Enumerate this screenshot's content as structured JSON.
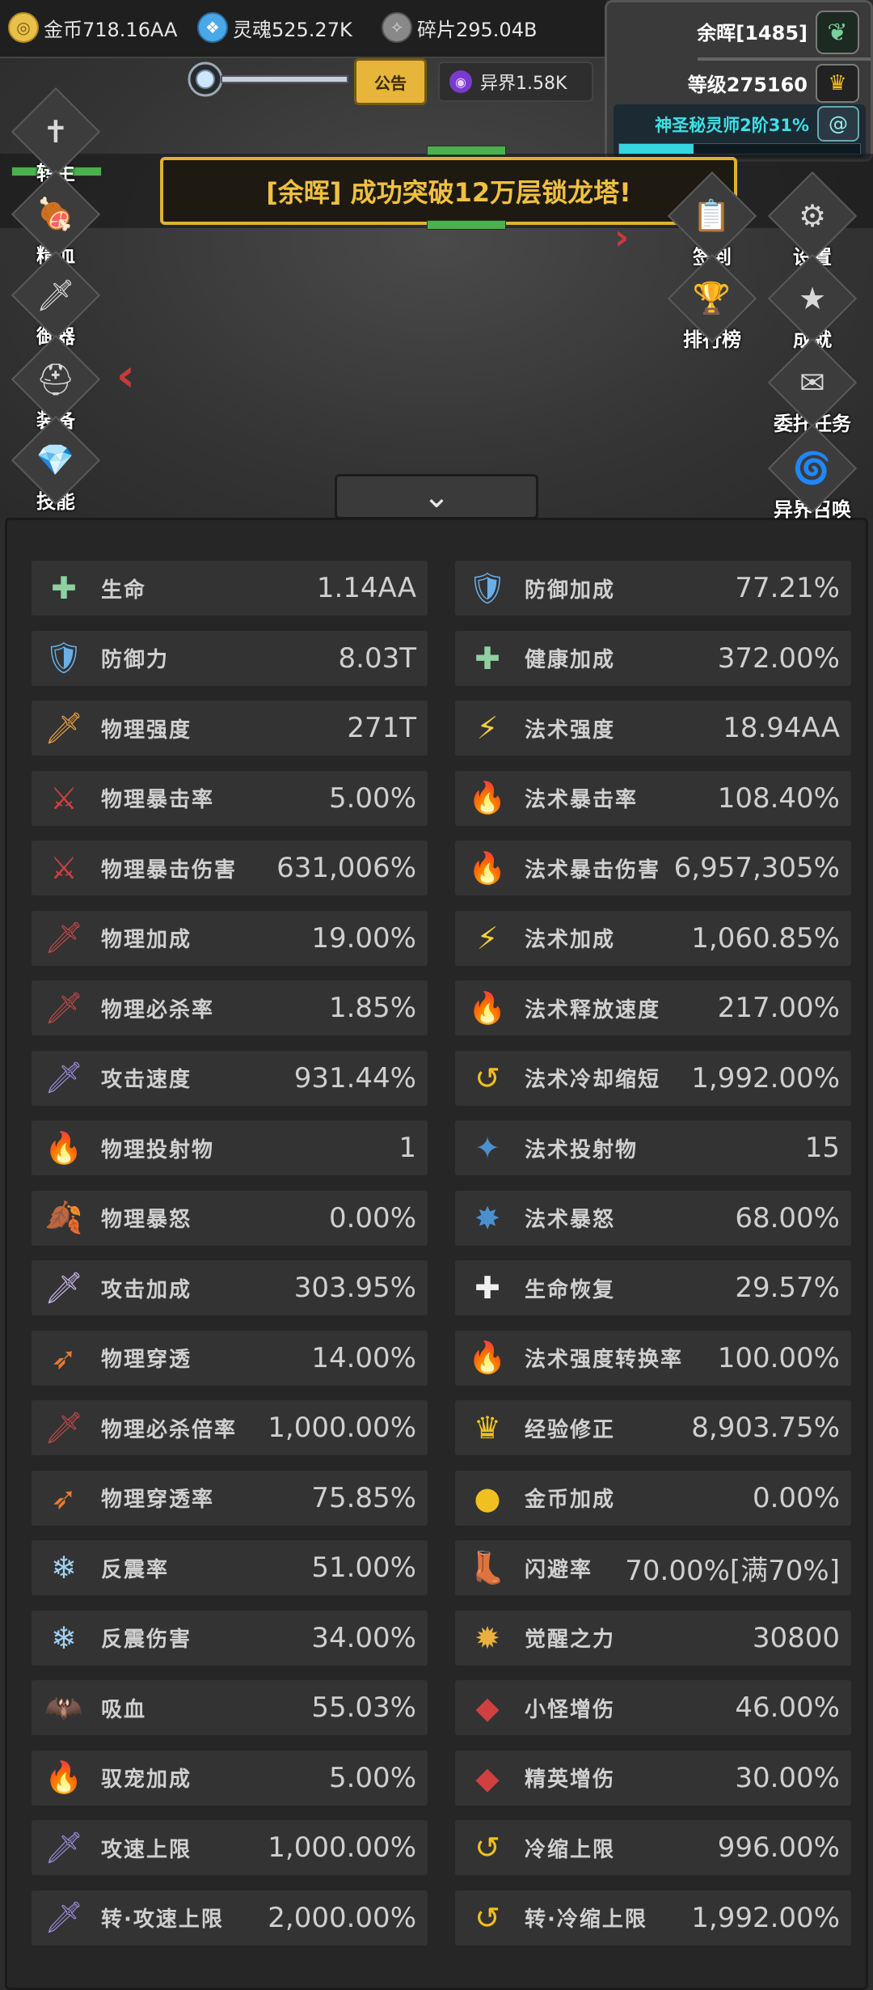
{
  "resources": {
    "gold": {
      "icon": "gold-coin-icon",
      "text": "金币718.16AA"
    },
    "soul": {
      "icon": "soul-flame-icon",
      "text": "灵魂525.27K"
    },
    "shard": {
      "icon": "shard-icon",
      "text": "碎片295.04B"
    }
  },
  "profile": {
    "name": "余晖[1485]",
    "level": "等级275160",
    "title": "神圣秘灵师2阶31%",
    "title_progress": 0.31
  },
  "notice_label": "公告",
  "otherworld_text": "异界1.58K",
  "banner_text": "[余晖] 成功突破12万层锁龙塔!",
  "left_menu": [
    {
      "label": "转生",
      "icon": "sword-cross-icon",
      "glyph": "✝"
    },
    {
      "label": "精血",
      "icon": "meat-icon",
      "glyph": "🍖"
    },
    {
      "label": "御器",
      "icon": "flying-sword-icon",
      "glyph": "🗡"
    },
    {
      "label": "装备",
      "icon": "helmet-icon",
      "glyph": "⛑"
    },
    {
      "label": "技能",
      "icon": "crystal-icon",
      "glyph": "💎"
    }
  ],
  "right_menu": [
    {
      "label": "签到",
      "icon": "signin-board-icon",
      "glyph": "📋"
    },
    {
      "label": "设置",
      "icon": "gear-icon",
      "glyph": "⚙"
    },
    {
      "label": "排行榜",
      "icon": "trophy-icon",
      "glyph": "🏆"
    },
    {
      "label": "成就",
      "icon": "star-icon",
      "glyph": "★"
    },
    {
      "label": "委托任务",
      "icon": "envelope-icon",
      "glyph": "✉"
    },
    {
      "label": "异界召唤",
      "icon": "portal-icon",
      "glyph": "🌀"
    }
  ],
  "stats_left": [
    {
      "name": "生命",
      "value": "1.14AA",
      "icon": "life-cross-icon",
      "glyph": "✚",
      "color": "#8fd0a0"
    },
    {
      "name": "防御力",
      "value": "8.03T",
      "icon": "shield-icon",
      "glyph": "🛡",
      "color": "#6ab0e8"
    },
    {
      "name": "物理强度",
      "value": "271T",
      "icon": "fire-blade-icon",
      "glyph": "🗡",
      "color": "#e8a040"
    },
    {
      "name": "物理暴击率",
      "value": "5.00%",
      "icon": "red-slash-icon",
      "glyph": "⚔",
      "color": "#d04040"
    },
    {
      "name": "物理暴击伤害",
      "value": "631,006%",
      "icon": "red-slash-icon",
      "glyph": "⚔",
      "color": "#d04040"
    },
    {
      "name": "物理加成",
      "value": "19.00%",
      "icon": "bleeding-blade-icon",
      "glyph": "🗡",
      "color": "#c04848"
    },
    {
      "name": "物理必杀率",
      "value": "1.85%",
      "icon": "bleeding-blade-icon",
      "glyph": "🗡",
      "color": "#c04848"
    },
    {
      "name": "攻击速度",
      "value": "931.44%",
      "icon": "speed-sword-icon",
      "glyph": "🗡",
      "color": "#9a8ad8"
    },
    {
      "name": "物理投射物",
      "value": "1",
      "icon": "fireball-icon",
      "glyph": "🔥",
      "color": "#e86a20"
    },
    {
      "name": "物理暴怒",
      "value": "0.00%",
      "icon": "yellow-leaf-icon",
      "glyph": "🍂",
      "color": "#f0c020"
    },
    {
      "name": "攻击加成",
      "value": "303.95%",
      "icon": "sword-icon",
      "glyph": "🗡",
      "color": "#c8b8e8"
    },
    {
      "name": "物理穿透",
      "value": "14.00%",
      "icon": "pierce-arrows-icon",
      "glyph": "➶",
      "color": "#e87a30"
    },
    {
      "name": "物理必杀倍率",
      "value": "1,000.00%",
      "icon": "bleeding-blade-icon",
      "glyph": "🗡",
      "color": "#c04848"
    },
    {
      "name": "物理穿透率",
      "value": "75.85%",
      "icon": "pierce-arrows-icon",
      "glyph": "➶",
      "color": "#e87a30"
    },
    {
      "name": "反震率",
      "value": "51.00%",
      "icon": "ice-burst-icon",
      "glyph": "❄",
      "color": "#a0d0f0"
    },
    {
      "name": "反震伤害",
      "value": "34.00%",
      "icon": "ice-burst-icon",
      "glyph": "❄",
      "color": "#a0d0f0"
    },
    {
      "name": "吸血",
      "value": "55.03%",
      "icon": "bat-icon",
      "glyph": "🦇",
      "color": "#c02020"
    },
    {
      "name": "驭宠加成",
      "value": "5.00%",
      "icon": "flame-pet-icon",
      "glyph": "🔥",
      "color": "#e86a20"
    },
    {
      "name": "攻速上限",
      "value": "1,000.00%",
      "icon": "speed-sword-icon",
      "glyph": "🗡",
      "color": "#9a8ad8"
    },
    {
      "name": "转·攻速上限",
      "value": "2,000.00%",
      "icon": "speed-sword-icon",
      "glyph": "🗡",
      "color": "#9a8ad8"
    }
  ],
  "stats_right": [
    {
      "name": "防御加成",
      "value": "77.21%",
      "icon": "shield-icon",
      "glyph": "🛡",
      "color": "#6ab0e8"
    },
    {
      "name": "健康加成",
      "value": "372.00%",
      "icon": "life-cross-icon",
      "glyph": "✚",
      "color": "#8fd0a0"
    },
    {
      "name": "法术强度",
      "value": "18.94AA",
      "icon": "lightning-icon",
      "glyph": "⚡",
      "color": "#f0d040"
    },
    {
      "name": "法术暴击率",
      "value": "108.40%",
      "icon": "blue-flame-icon",
      "glyph": "🔥",
      "color": "#4aa8f0"
    },
    {
      "name": "法术暴击伤害",
      "value": "6,957,305%",
      "icon": "blue-flame-icon",
      "glyph": "🔥",
      "color": "#4aa8f0"
    },
    {
      "name": "法术加成",
      "value": "1,060.85%",
      "icon": "lightning-icon",
      "glyph": "⚡",
      "color": "#f0d040"
    },
    {
      "name": "法术释放速度",
      "value": "217.00%",
      "icon": "orange-flame-icon",
      "glyph": "🔥",
      "color": "#e8a040"
    },
    {
      "name": "法术冷却缩短",
      "value": "1,992.00%",
      "icon": "cooldown-arrow-icon",
      "glyph": "↺",
      "color": "#f0c020"
    },
    {
      "name": "法术投射物",
      "value": "15",
      "icon": "blue-shard-icon",
      "glyph": "✦",
      "color": "#4a90d0"
    },
    {
      "name": "法术暴怒",
      "value": "68.00%",
      "icon": "blue-burst-icon",
      "glyph": "✸",
      "color": "#4a90d0"
    },
    {
      "name": "生命恢复",
      "value": "29.57%",
      "icon": "regen-cross-icon",
      "glyph": "✚",
      "color": "#f0f0f0"
    },
    {
      "name": "法术强度转换率",
      "value": "100.00%",
      "icon": "blue-flame-icon",
      "glyph": "🔥",
      "color": "#4aa8f0"
    },
    {
      "name": "经验修正",
      "value": "8,903.75%",
      "icon": "crown-icon",
      "glyph": "♛",
      "color": "#f0c020"
    },
    {
      "name": "金币加成",
      "value": "0.00%",
      "icon": "gold-coin-icon",
      "glyph": "●",
      "color": "#f0c020"
    },
    {
      "name": "闪避率",
      "value": "70.00%[满70%]",
      "icon": "boot-icon",
      "glyph": "👢",
      "color": "#f0e8a0"
    },
    {
      "name": "觉醒之力",
      "value": "30800",
      "icon": "sun-medal-icon",
      "glyph": "✹",
      "color": "#e8b040"
    },
    {
      "name": "小怪增伤",
      "value": "46.00%",
      "icon": "red-gem-icon",
      "glyph": "◆",
      "color": "#d04040"
    },
    {
      "name": "精英增伤",
      "value": "30.00%",
      "icon": "red-gem-icon",
      "glyph": "◆",
      "color": "#d04040"
    },
    {
      "name": "冷缩上限",
      "value": "996.00%",
      "icon": "cooldown-arrow-icon",
      "glyph": "↺",
      "color": "#f0c020"
    },
    {
      "name": "转·冷缩上限",
      "value": "1,992.00%",
      "icon": "cooldown-arrow-icon",
      "glyph": "↺",
      "color": "#f0c020"
    }
  ]
}
